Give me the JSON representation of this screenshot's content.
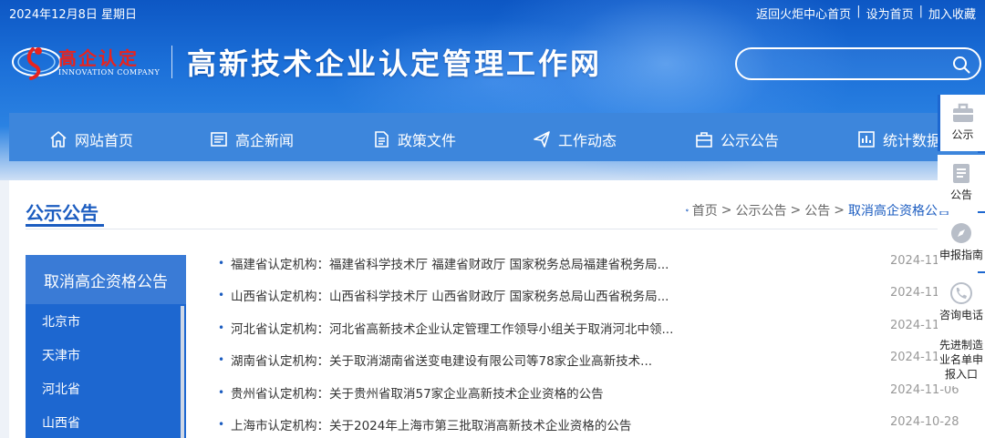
{
  "topbar": {
    "date": "2024年12月8日 星期日",
    "links": [
      "返回火炬中心首页",
      "设为首页",
      "加入收藏"
    ],
    "separator": "|"
  },
  "logo": {
    "text": "高企认定",
    "subtext": "INNOVATION COMPANY"
  },
  "site_title": "高新技术企业认定管理工作网",
  "search": {
    "placeholder": "",
    "value": ""
  },
  "nav": [
    {
      "label": "网站首页",
      "icon": "home-icon"
    },
    {
      "label": "高企新闻",
      "icon": "news-icon"
    },
    {
      "label": "政策文件",
      "icon": "document-icon"
    },
    {
      "label": "工作动态",
      "icon": "send-icon"
    },
    {
      "label": "公示公告",
      "icon": "announcement-icon"
    },
    {
      "label": "统计数据",
      "icon": "chart-icon"
    }
  ],
  "section": {
    "title": "公示公告",
    "breadcrumb": [
      "首页",
      "公示公告",
      "公告",
      "取消高企资格公告"
    ],
    "breadcrumb_sep": ">"
  },
  "sidebar": {
    "heading": "取消高企资格公告",
    "items": [
      "北京市",
      "天津市",
      "河北省",
      "山西省"
    ]
  },
  "news": [
    {
      "title": "福建省认定机构：福建省科学技术厅 福建省财政厅 国家税务总局福建省税务局...",
      "date": "2024-11-"
    },
    {
      "title": "山西省认定机构：山西省科学技术厅 山西省财政厅 国家税务总局山西省税务局...",
      "date": "2024-11-"
    },
    {
      "title": "河北省认定机构：河北省高新技术企业认定管理工作领导小组关于取消河北中领...",
      "date": "2024-11-"
    },
    {
      "title": "湖南省认定机构：关于取消湖南省送变电建设有限公司等78家企业高新技术...",
      "date": "2024-11-"
    },
    {
      "title": "贵州省认定机构：关于贵州省取消57家企业高新技术企业资格的公告",
      "date": "2024-11-06"
    },
    {
      "title": "上海市认定机构：关于2024年上海市第三批取消高新技术企业资格的公告",
      "date": "2024-10-28"
    }
  ],
  "float_panel": [
    {
      "label": "公示",
      "icon": "briefcase-icon"
    },
    {
      "label": "公告",
      "icon": "notepad-icon"
    },
    {
      "label": "申报指南",
      "icon": "compass-icon"
    },
    {
      "label": "咨询电话",
      "icon": "phone-icon"
    },
    {
      "label": "先进制造业名单申报入口",
      "lines": [
        "先进制造",
        "业名单申",
        "报入口"
      ],
      "icon": ""
    }
  ],
  "colors": {
    "header_blue": "#1b6fd8",
    "nav_blue": "#3d86dc",
    "sidebar_blue": "#1d67d0",
    "accent": "#1b5cc0",
    "logo_red": "#e8231e"
  }
}
